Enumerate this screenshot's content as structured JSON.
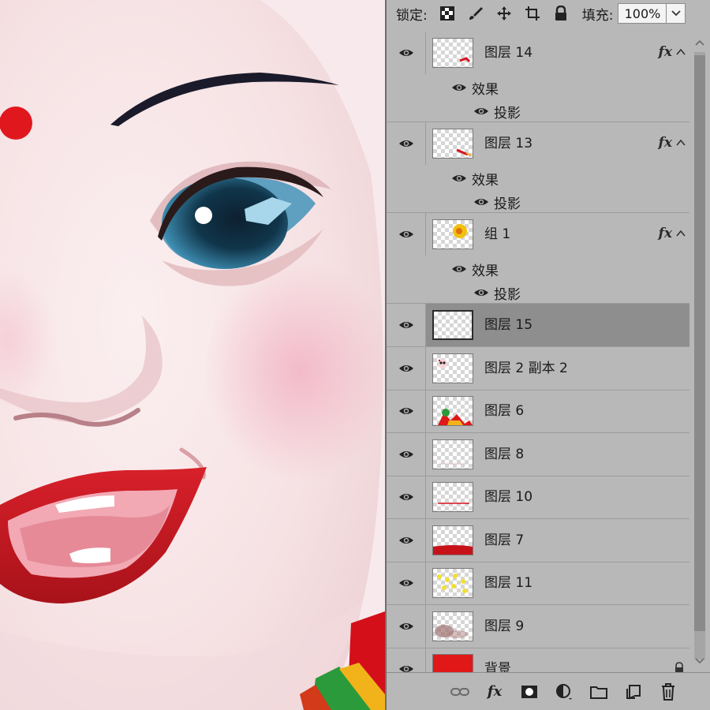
{
  "lockbar": {
    "lock_label": "锁定:",
    "fill_label": "填充:",
    "fill_value": "100%",
    "icons": [
      "lock-transparent-icon",
      "lock-image-brush-icon",
      "lock-position-move-icon",
      "lock-artboard-icon",
      "lock-all-padlock-icon",
      "chevron-down-icon"
    ]
  },
  "layers": [
    {
      "name": "图层 14",
      "fx": "fx",
      "effects_label": "效果",
      "effect": "投影",
      "thumb": "red-stroke"
    },
    {
      "name": "图层 13",
      "fx": "fx",
      "effects_label": "效果",
      "effect": "投影",
      "thumb": "red-dash"
    },
    {
      "name": "组 1",
      "fx": "fx",
      "effects_label": "效果",
      "effect": "投影",
      "thumb": "yellow-blob",
      "is_group": true
    },
    {
      "name": "图层 15",
      "selected": true,
      "thumb": "empty"
    },
    {
      "name": "图层 2 副本 2",
      "thumb": "small-face"
    },
    {
      "name": "图层 6",
      "thumb": "colorful"
    },
    {
      "name": "图层 8",
      "thumb": "faint-line"
    },
    {
      "name": "图层 10",
      "thumb": "red-line"
    },
    {
      "name": "图层 7",
      "thumb": "red-bottom"
    },
    {
      "name": "图层 11",
      "thumb": "yellow-dots"
    },
    {
      "name": "图层 9",
      "thumb": "brown-stain"
    },
    {
      "name": "背景",
      "thumb": "solid-red",
      "locked": true
    }
  ],
  "bottom_toolbar": {
    "icons": [
      "link-layers-icon",
      "fx-icon",
      "add-mask-icon",
      "adjustment-layer-icon",
      "new-group-folder-icon",
      "new-layer-icon",
      "delete-trash-icon"
    ],
    "fx_text": "fx"
  },
  "colors": {
    "panel_bg": "#b8b8b8",
    "selected_row": "#8e8e8e",
    "bindi_red": "#e0181e",
    "lip_red": "#c81a22"
  }
}
